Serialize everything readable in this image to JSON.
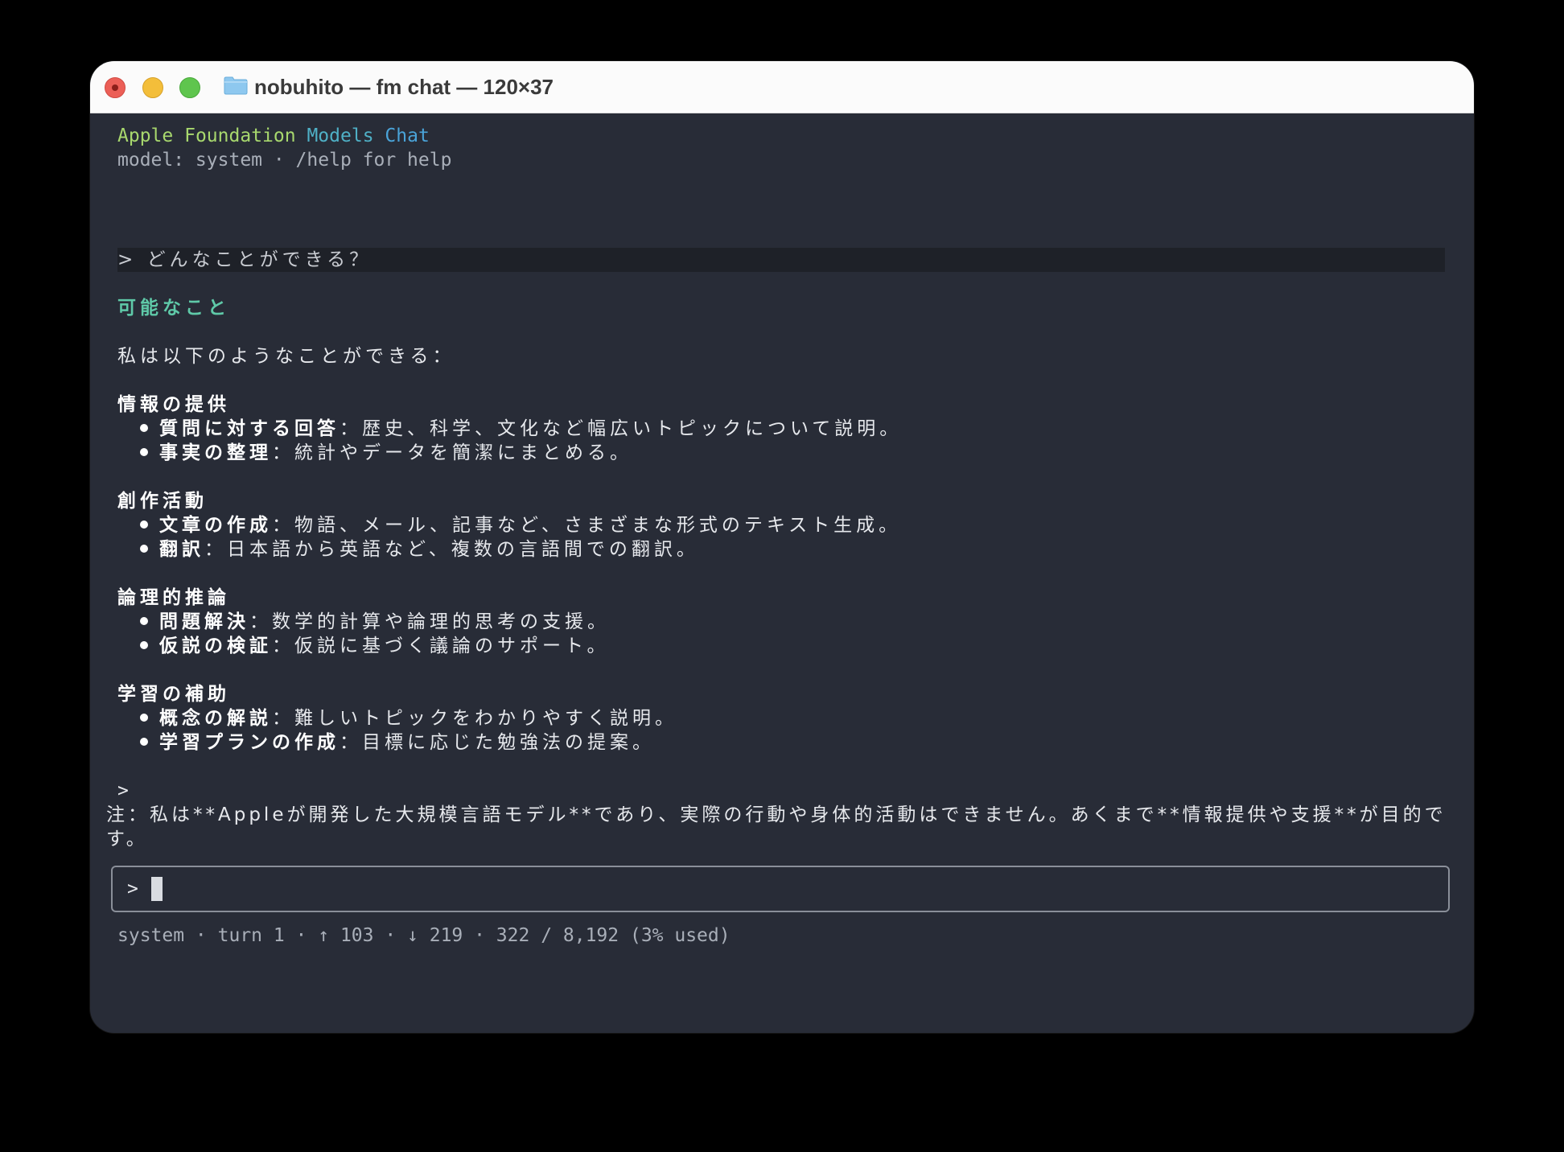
{
  "window": {
    "title": "nobuhito — fm chat — 120×37"
  },
  "header": {
    "app_title_words": [
      "Apple",
      "Foundation",
      "Models",
      "Chat"
    ],
    "model_line": "model: system · /help for help"
  },
  "conversation": {
    "user_prompt": "> どんなことができる？",
    "response_heading": "可能なこと",
    "intro": "私は以下のようなことができる：",
    "sections": [
      {
        "title": "情報の提供",
        "items": [
          {
            "bold": "質問に対する回答",
            "text": "：歴史、科学、文化など幅広いトピックについて説明。"
          },
          {
            "bold": "事実の整理",
            "text": "：統計やデータを簡潔にまとめる。"
          }
        ]
      },
      {
        "title": "創作活動",
        "items": [
          {
            "bold": "文章の作成",
            "text": "：物語、メール、記事など、さまざまな形式のテキスト生成。"
          },
          {
            "bold": "翻訳",
            "text": "：日本語から英語など、複数の言語間での翻訳。"
          }
        ]
      },
      {
        "title": "論理的推論",
        "items": [
          {
            "bold": "問題解決",
            "text": "：数学的計算や論理的思考の支援。"
          },
          {
            "bold": "仮説の検証",
            "text": "：仮説に基づく議論のサポート。"
          }
        ]
      },
      {
        "title": "学習の補助",
        "items": [
          {
            "bold": "概念の解説",
            "text": "：難しいトピックをわかりやすく説明。"
          },
          {
            "bold": "学習プランの作成",
            "text": "：目標に応じた勉強法の提案。"
          }
        ]
      }
    ],
    "quote_marker": ">",
    "note": "注：私は**Appleが開発した大規模言語モデル**であり、実際の行動や身体的活動はできません。あくまで**情報提供や支援**が目的です。"
  },
  "input": {
    "prompt": ">",
    "value": ""
  },
  "status_bar": {
    "text": "system · turn 1 · ↑ 103 · ↓ 219 · 322 / 8,192 (3% used)"
  },
  "colors": {
    "terminal_bg": "#282c37",
    "heading_green": "#5fc9a8",
    "title_green": "#a8d86e",
    "title_teal": "#4fb0c6",
    "title_blue": "#4aa3d8"
  }
}
